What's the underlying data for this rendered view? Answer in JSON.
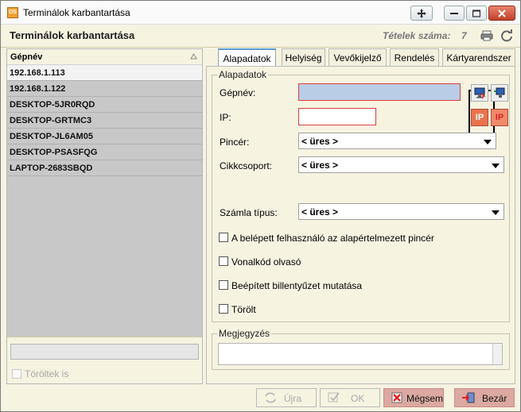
{
  "window": {
    "title": "Terminálok karbantartása",
    "icon_text": "OS"
  },
  "header": {
    "title": "Terminálok karbantartása",
    "count_label": "Tételek száma:",
    "count_value": "7"
  },
  "list": {
    "column": "Gépnév",
    "rows": [
      {
        "name": "192.168.1.113",
        "selected": true
      },
      {
        "name": "192.168.1.122",
        "selected": false
      },
      {
        "name": "DESKTOP-5JR0RQD",
        "selected": false
      },
      {
        "name": "DESKTOP-GRTMC3",
        "selected": false
      },
      {
        "name": "DESKTOP-JL6AM05",
        "selected": false
      },
      {
        "name": "DESKTOP-PSASFQG",
        "selected": false
      },
      {
        "name": "LAPTOP-2683SBQD",
        "selected": false
      }
    ],
    "deleted_label": "Töröltek is"
  },
  "tabs": [
    {
      "label": "Alapadatok",
      "active": true
    },
    {
      "label": "Helyiség",
      "active": false
    },
    {
      "label": "Vevőkijelző",
      "active": false
    },
    {
      "label": "Rendelés",
      "active": false
    },
    {
      "label": "Kártyarendszer",
      "active": false
    }
  ],
  "form": {
    "group_title": "Alapadatok",
    "machine_name_label": "Gépnév:",
    "machine_name_value": "",
    "ip_label": "IP:",
    "ip_value": "",
    "ip_button_text": "IP",
    "waiter_label": "Pincér:",
    "waiter_value": "< üres >",
    "item_group_label": "Cikkcsoport:",
    "item_group_value": "< üres >",
    "invoice_type_label": "Számla típus:",
    "invoice_type_value": "< üres >",
    "checkboxes": [
      {
        "label": "A belépett felhasználó az alapértelmezett pincér",
        "checked": false
      },
      {
        "label": "Vonalkód olvasó",
        "checked": false
      },
      {
        "label": "Beépített billentyűzet mutatása",
        "checked": false
      },
      {
        "label": "Törölt",
        "checked": false
      }
    ],
    "notes_title": "Megjegyzés",
    "notes_value": ""
  },
  "buttons": {
    "renew": "Újra",
    "ok": "OK",
    "cancel": "Mégsem",
    "close": "Bezár"
  },
  "colors": {
    "background": "#f6f3e1",
    "list_bg": "#c8c8c8",
    "error_border": "#e03a3a",
    "active_tab_accent": "#5a9ad8",
    "danger_button": "#dba9a1"
  }
}
